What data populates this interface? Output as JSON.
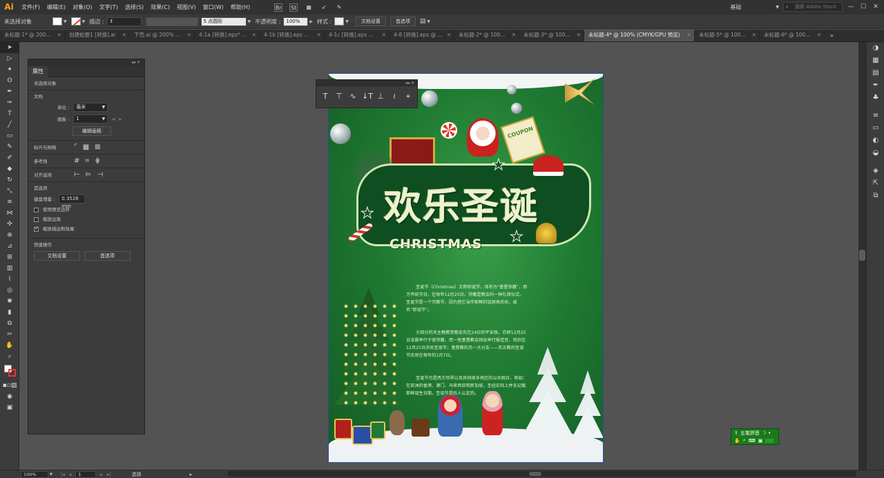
{
  "menubar": {
    "logo": "Ai",
    "items": [
      "文件(F)",
      "编辑(E)",
      "对象(O)",
      "文字(T)",
      "选择(S)",
      "效果(C)",
      "视图(V)",
      "窗口(W)",
      "帮助(H)"
    ],
    "icons": [
      {
        "icon": "bridge-icon",
        "label": "Br"
      },
      {
        "icon": "stock-icon",
        "label": "St"
      }
    ],
    "workspace": "基础",
    "search_placeholder": "搜索 Adobe Stock"
  },
  "controlbar": {
    "selection": "未选择对象",
    "stroke_label": "描边 :",
    "brush": "5 点圆形",
    "opacity_label": "不透明度 :",
    "opacity": "100%",
    "style_label": "样式 :",
    "doc_settings": "文档设置",
    "preferences": "首选项"
  },
  "tabs": [
    "未标题-1* @ 200...",
    "创建蛇磨1 [转换].ai",
    "下壳.ai @ 200% ...",
    "4-1a [转换].eps* ...",
    "4-1b [转换].eps ...",
    "4-1c [转换].eps ...",
    "4-8 [转换].eps @ ...",
    "未标题-2* @ 100...",
    "未标题-3* @ 100...",
    "未标题-4* @ 100% (CMYK/GPU 预览)",
    "未标题-5* @ 100...",
    "未标题-6* @ 100..."
  ],
  "active_tab": 9,
  "properties": {
    "tab": "属性",
    "no_selection": "未选择对象",
    "document": "文档",
    "unit_label": "单位 :",
    "unit": "毫米",
    "artboard_label": "画板 :",
    "artboard": "1",
    "edit_artboard": "编辑画板",
    "rulers_grids": "标尺与网格",
    "guides": "参考线",
    "align": "对齐选项",
    "prefs": "首选项",
    "keyboard_inc_label": "键盘增量 :",
    "keyboard_inc": "0.3528 mm",
    "use_preview_bounds": "使用预览边界",
    "scale_corners": "缩放边角",
    "scale_strokes": "缩放描边和效果",
    "quick_actions": "快速操作",
    "doc_settings_btn": "文档设置",
    "prefs_btn": "首选项"
  },
  "artwork": {
    "title_cn": "欢乐圣诞",
    "title_en": "CHRISTMAS",
    "body_p1": "圣诞节（Christmas）又称耶诞节，译名为“基督弥撒”，西方传统节日，在每年12月25日。弥撒是教会的一种礼拜仪式。圣诞节是一个宗教节，因为把它当作耶稣的诞辰来庆祝，故名“耶诞节”。",
    "body_p2": "大部分的天主教教堂都会先在24日的平安夜，亦即12月25日凌晨举行子夜弥撒，而一些基督教会则会举行报佳音，然后在12月25日庆祝圣诞节；基督教的另一大分支——东正教的圣诞节庆则在每年的1月7日。",
    "body_p3": "圣诞节也是西方世界以及其他很多地区的公共假日，例如：在亚洲的香港、澳门、马来西亚和新加坡，圣经实际上并无记载耶稣诞生日期，圣诞节是后人公定的。",
    "coupon": "COUPON"
  },
  "ime": {
    "name": "五笔拼音"
  },
  "status": {
    "zoom": "100%",
    "artboard": "1",
    "tool": "选择"
  }
}
